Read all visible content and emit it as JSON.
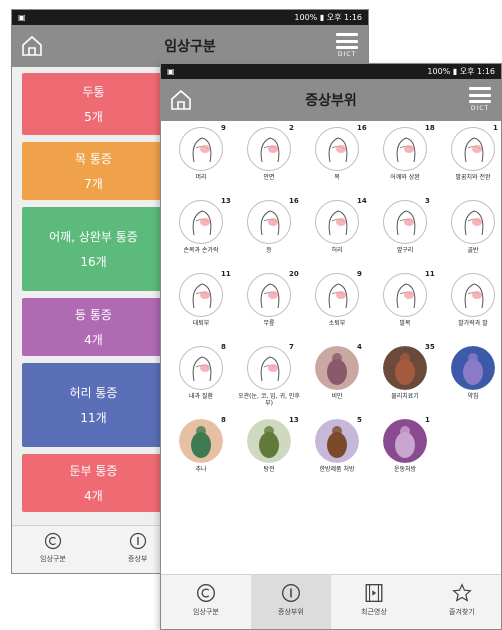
{
  "back": {
    "status": {
      "time": "100% ▮ 오후 1:16"
    },
    "title": "임상구분",
    "menu_label": "DICT",
    "categories": [
      {
        "name": "두통",
        "count": "5개",
        "color": "#ee6b73"
      },
      {
        "name": "목 통증",
        "count": "7개",
        "color": "#f0a24b"
      },
      {
        "name": "어깨, 상완부 통증",
        "count": "16개",
        "color": "#5cba7d"
      },
      {
        "name": "등 통증",
        "count": "4개",
        "color": "#b06ab3"
      },
      {
        "name": "허리 통증",
        "count": "11개",
        "color": "#5b6fb8"
      },
      {
        "name": "둔부 통증",
        "count": "4개",
        "color": "#ee6b73"
      }
    ],
    "nav": [
      {
        "label": "임상구분"
      },
      {
        "label": "증상부"
      }
    ]
  },
  "front": {
    "status": {
      "time": "100% ▮ 오후 1:16"
    },
    "title": "증상부위",
    "menu_label": "DICT",
    "items": [
      {
        "label": "머리",
        "badge": "9",
        "icon": "head-icon"
      },
      {
        "label": "안면",
        "badge": "2",
        "icon": "face-icon"
      },
      {
        "label": "목",
        "badge": "16",
        "icon": "neck-icon"
      },
      {
        "label": "어깨와 상완",
        "badge": "18",
        "icon": "shoulder-icon"
      },
      {
        "label": "팔꿈치와 전완",
        "badge": "1",
        "icon": "elbow-icon"
      },
      {
        "label": "손목과 손가락",
        "badge": "13",
        "icon": "wrist-icon"
      },
      {
        "label": "등",
        "badge": "16",
        "icon": "back-icon"
      },
      {
        "label": "허리",
        "badge": "14",
        "icon": "waist-icon"
      },
      {
        "label": "옆구리",
        "badge": "3",
        "icon": "flank-icon"
      },
      {
        "label": "골반",
        "badge": "",
        "icon": "pelvis-icon"
      },
      {
        "label": "대퇴부",
        "badge": "11",
        "icon": "thigh-icon"
      },
      {
        "label": "무릎",
        "badge": "20",
        "icon": "knee-icon"
      },
      {
        "label": "소퇴부",
        "badge": "9",
        "icon": "calf-icon"
      },
      {
        "label": "발목",
        "badge": "11",
        "icon": "ankle-icon"
      },
      {
        "label": "발가락과 발",
        "badge": "",
        "icon": "foot-icon"
      },
      {
        "label": "내과 질환",
        "badge": "8",
        "icon": "ear-icon"
      },
      {
        "label": "오관(눈, 코, 입, 귀, 인후부)",
        "badge": "7",
        "icon": "five-senses-icon"
      },
      {
        "label": "비만",
        "badge": "4",
        "icon": "obesity-photo"
      },
      {
        "label": "물리치료기",
        "badge": "35",
        "icon": "physio-photo"
      },
      {
        "label": "약침",
        "badge": "",
        "icon": "injection-photo"
      },
      {
        "label": "추나",
        "badge": "8",
        "icon": "chuna-photo"
      },
      {
        "label": "탕전",
        "badge": "13",
        "icon": "herb-photo"
      },
      {
        "label": "한방제품 처방",
        "badge": "5",
        "icon": "products-photo"
      },
      {
        "label": "운동처방",
        "badge": "1",
        "icon": "exercise-photo"
      }
    ],
    "nav": [
      {
        "label": "임상구분"
      },
      {
        "label": "증상부위"
      },
      {
        "label": "최근영상"
      },
      {
        "label": "즐겨찾기"
      }
    ]
  }
}
